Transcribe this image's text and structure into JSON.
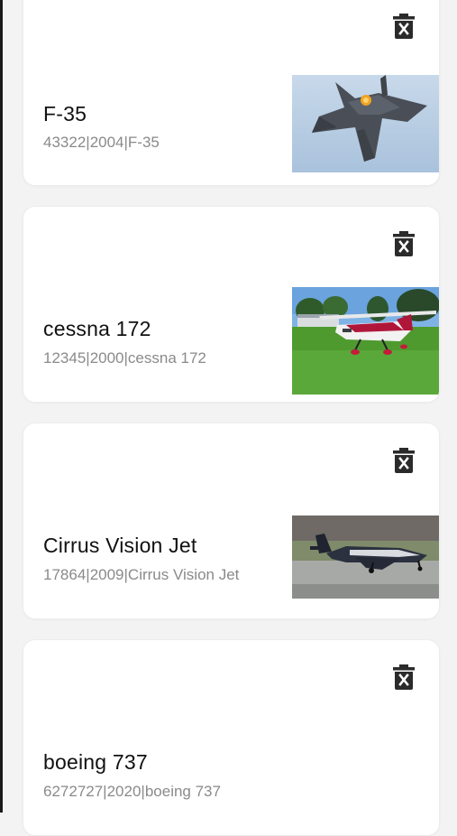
{
  "aircraft": [
    {
      "name": "F-35",
      "details": "43322|2004|F-35",
      "image": "f35-jet-photo"
    },
    {
      "name": "cessna 172",
      "details": "12345|2000|cessna 172",
      "image": "cessna-on-grass-photo"
    },
    {
      "name": "Cirrus Vision Jet",
      "details": "17864|2009|Cirrus Vision Jet",
      "image": "cirrus-vision-jet-photo"
    },
    {
      "name": "boeing 737",
      "details": "6272727|2020|boeing 737",
      "image": ""
    }
  ],
  "icons": {
    "delete": "trash-x-icon"
  },
  "colors": {
    "icon": "#2b2b2b",
    "title": "#111111",
    "subtitle": "#8a8a8a",
    "card": "#ffffff",
    "background": "#f3f3f3"
  }
}
